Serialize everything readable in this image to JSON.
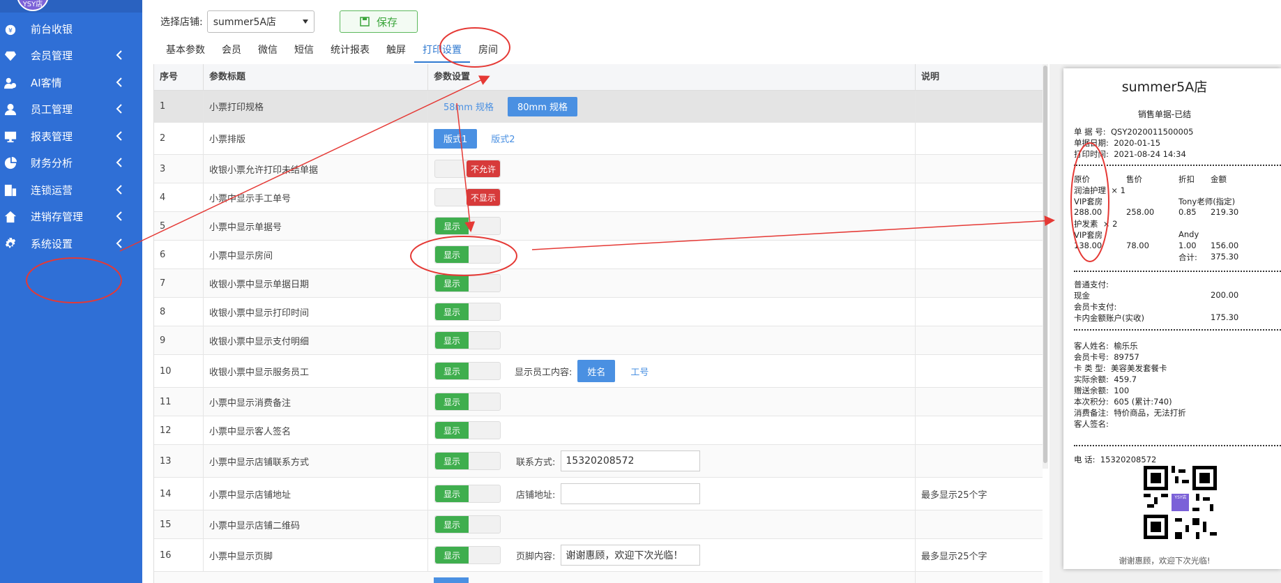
{
  "sidebar": {
    "avatar_text": "YSY店",
    "items": [
      {
        "label": "前台收银",
        "icon": "cashier-icon",
        "chevron": false
      },
      {
        "label": "会员管理",
        "icon": "diamond-icon",
        "chevron": true
      },
      {
        "label": "AI客情",
        "icon": "users-icon",
        "chevron": true
      },
      {
        "label": "员工管理",
        "icon": "user-icon",
        "chevron": true
      },
      {
        "label": "报表管理",
        "icon": "monitor-icon",
        "chevron": true
      },
      {
        "label": "财务分析",
        "icon": "pie-icon",
        "chevron": true
      },
      {
        "label": "连锁运营",
        "icon": "building-icon",
        "chevron": true
      },
      {
        "label": "进销存管理",
        "icon": "home-icon",
        "chevron": true
      },
      {
        "label": "系统设置",
        "icon": "gear-icon",
        "chevron": true
      }
    ]
  },
  "toolbar": {
    "store_label": "选择店铺:",
    "store_value": "summer5A店",
    "save_label": "保存"
  },
  "tabs": [
    "基本参数",
    "会员",
    "微信",
    "短信",
    "统计报表",
    "触屏",
    "打印设置",
    "房间"
  ],
  "active_tab": "打印设置",
  "table": {
    "headers": [
      "序号",
      "参数标题",
      "参数设置",
      "说明"
    ],
    "rows": [
      {
        "no": "1",
        "title": "小票打印规格",
        "opt_a": "58mm 规格",
        "opt_b": "80mm 规格",
        "note": ""
      },
      {
        "no": "2",
        "title": "小票排版",
        "opt_a": "版式1",
        "opt_b": "版式2",
        "note": ""
      },
      {
        "no": "3",
        "title": "收银小票允许打印未结单据",
        "toggle": "不允许",
        "note": ""
      },
      {
        "no": "4",
        "title": "小票中显示手工单号",
        "toggle": "不显示",
        "note": ""
      },
      {
        "no": "5",
        "title": "小票中显示单据号",
        "toggle": "显示",
        "note": ""
      },
      {
        "no": "6",
        "title": "小票中显示房间",
        "toggle": "显示",
        "note": ""
      },
      {
        "no": "7",
        "title": "收银小票中显示单据日期",
        "toggle": "显示",
        "note": ""
      },
      {
        "no": "8",
        "title": "收银小票中显示打印时间",
        "toggle": "显示",
        "note": ""
      },
      {
        "no": "9",
        "title": "收银小票中显示支付明细",
        "toggle": "显示",
        "note": ""
      },
      {
        "no": "10",
        "title": "收银小票中显示服务员工",
        "toggle": "显示",
        "extra_label": "显示员工内容:",
        "opt_a": "姓名",
        "opt_b": "工号",
        "note": ""
      },
      {
        "no": "11",
        "title": "小票中显示消费备注",
        "toggle": "显示",
        "note": ""
      },
      {
        "no": "12",
        "title": "小票中显示客人签名",
        "toggle": "显示",
        "note": ""
      },
      {
        "no": "13",
        "title": "小票中显示店铺联系方式",
        "toggle": "显示",
        "extra_label": "联系方式:",
        "input_value": "15320208572",
        "note": ""
      },
      {
        "no": "14",
        "title": "小票中显示店铺地址",
        "toggle": "显示",
        "extra_label": "店铺地址:",
        "input_value": "",
        "note": "最多显示25个字"
      },
      {
        "no": "15",
        "title": "小票中显示店铺二维码",
        "toggle": "显示",
        "note": ""
      },
      {
        "no": "16",
        "title": "小票中显示页脚",
        "toggle": "显示",
        "extra_label": "页脚内容:",
        "input_value": "谢谢惠顾，欢迎下次光临！",
        "note": "最多显示25个字"
      }
    ]
  },
  "receipt": {
    "store": "summer5A店",
    "subtitle": "销售单据-已结",
    "lines": [
      {
        "k": "单 据 号:",
        "v": "QSY2020011500005"
      },
      {
        "k": "单据日期:",
        "v": "2020-01-15"
      },
      {
        "k": "打印时间:",
        "v": "2021-08-24 14:34"
      }
    ],
    "item_header": [
      "原价",
      "售价",
      "折扣",
      "金额"
    ],
    "items": [
      {
        "name": "润油护理",
        "qty": "× 1",
        "room": "VIP套房",
        "staff": "Tony老师(指定)",
        "price": "288.00",
        "sale": "258.00",
        "disc": "0.85",
        "amount": "219.30"
      },
      {
        "name": "护发素",
        "qty": "× 2",
        "room": "VIP套房",
        "staff": "Andy",
        "price": "138.00",
        "sale": "78.00",
        "disc": "1.00",
        "amount": "156.00"
      }
    ],
    "total_label": "合计:",
    "total": "375.30",
    "pay": [
      {
        "k": "普通支付:",
        "v": ""
      },
      {
        "k": "现金",
        "v": "200.00"
      },
      {
        "k": "会员卡支付:",
        "v": ""
      },
      {
        "k": "卡内金额账户(实收)",
        "v": "175.30"
      }
    ],
    "customer": [
      {
        "k": "客人姓名:",
        "v": "榆乐乐"
      },
      {
        "k": "会员卡号:",
        "v": "89757"
      },
      {
        "k": "卡 类 型:",
        "v": "美容美发套餐卡"
      },
      {
        "k": "实际余额:",
        "v": "459.7"
      },
      {
        "k": "赠送余额:",
        "v": "100"
      },
      {
        "k": "本次积分:",
        "v": "605 (累计:740)"
      },
      {
        "k": "消费备注:",
        "v": "特价商品，无法打折"
      },
      {
        "k": "客人签名:",
        "v": ""
      }
    ],
    "phone_label": "电    话:",
    "phone": "15320208572",
    "qr_badge": "YSY店",
    "footer": "谢谢惠顾，欢迎下次光临!"
  },
  "colors": {
    "sidebar": "#2f6fd6",
    "accent": "#4a90e2",
    "on": "#3fae4e",
    "off": "#d73a3a",
    "annotation": "#e53935"
  }
}
